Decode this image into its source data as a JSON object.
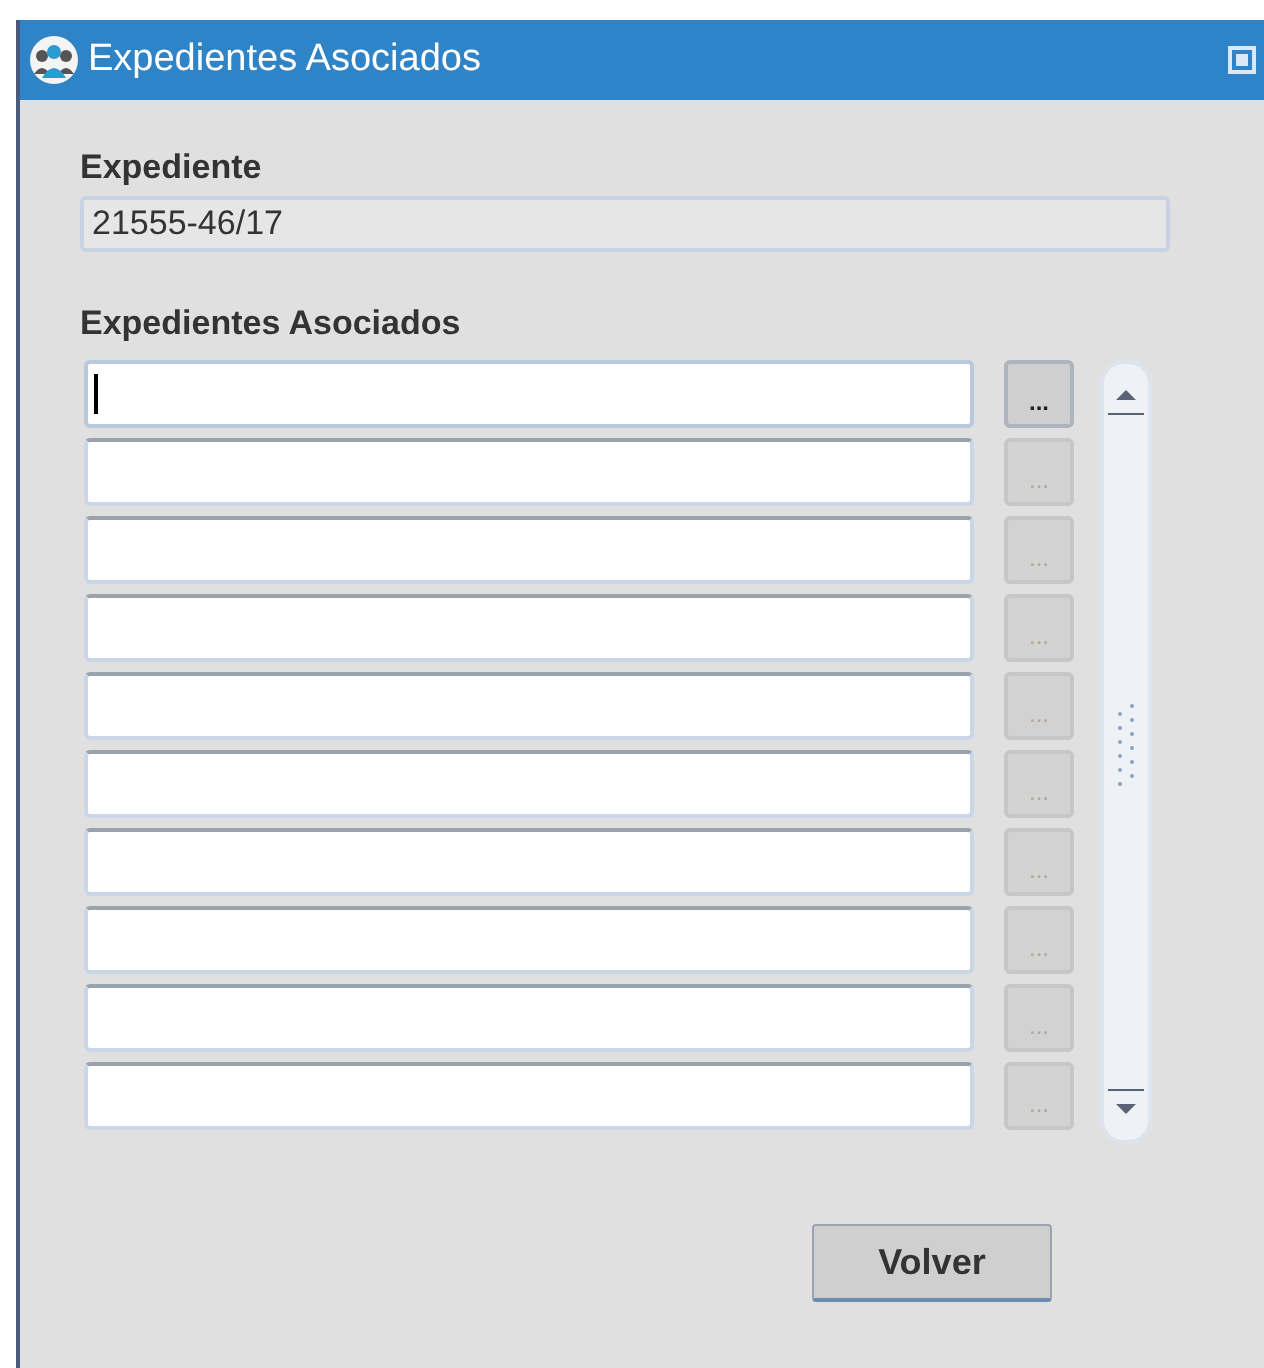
{
  "window": {
    "title": "Expedientes Asociados"
  },
  "expediente": {
    "label": "Expediente",
    "value": "21555-46/17"
  },
  "asociados": {
    "label": "Expedientes Asociados",
    "rows": [
      {
        "lookup": "...",
        "disabled": false,
        "focused": true
      },
      {
        "lookup": "...",
        "disabled": true,
        "focused": false
      },
      {
        "lookup": "...",
        "disabled": true,
        "focused": false
      },
      {
        "lookup": "...",
        "disabled": true,
        "focused": false
      },
      {
        "lookup": "...",
        "disabled": true,
        "focused": false
      },
      {
        "lookup": "...",
        "disabled": true,
        "focused": false
      },
      {
        "lookup": "...",
        "disabled": true,
        "focused": false
      },
      {
        "lookup": "...",
        "disabled": true,
        "focused": false
      },
      {
        "lookup": "...",
        "disabled": true,
        "focused": false
      },
      {
        "lookup": "...",
        "disabled": true,
        "focused": false
      }
    ]
  },
  "buttons": [
    "Volver"
  ]
}
